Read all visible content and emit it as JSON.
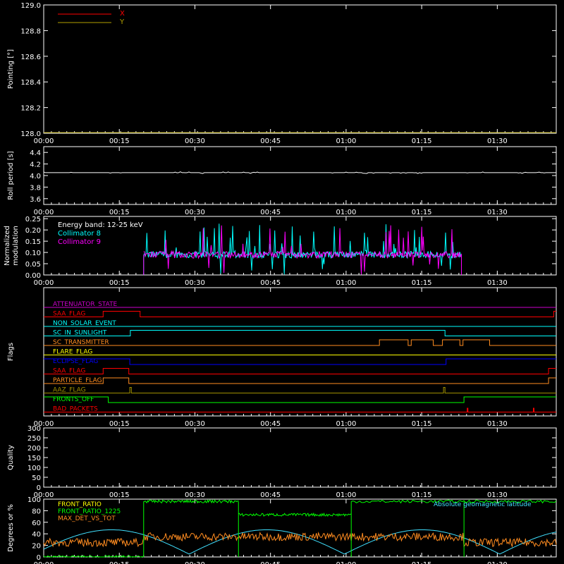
{
  "colors": {
    "background": "#000000",
    "axes": "#ffffff",
    "red": "#ff0000",
    "olive": "#b2a000",
    "cyan": "#00ffff",
    "magenta": "#ff00ff",
    "orange": "#ff8c20",
    "yellow": "#ffff00",
    "blue": "#0000ff",
    "green": "#00ff00",
    "olive_dark": "#a09000",
    "purple": "#cc00cc",
    "lightblue": "#40e0ff"
  },
  "time_ticks": [
    "00:00",
    "00:15",
    "00:30",
    "00:45",
    "01:00",
    "01:15",
    "01:30"
  ],
  "chart_data": [
    {
      "type": "line",
      "ylabel": "Pointing [°]",
      "ylim": [
        128.0,
        129.0
      ],
      "yticks": [
        "128.0",
        "128.2",
        "128.4",
        "128.6",
        "128.8",
        "129.0"
      ],
      "series": [
        {
          "name": "X",
          "color": "#ff0000",
          "values": []
        },
        {
          "name": "Y",
          "color": "#b2a000",
          "values": [
            [
              0,
              128.0
            ],
            [
              100,
              128.0
            ]
          ]
        }
      ]
    },
    {
      "type": "line",
      "ylabel": "Roll period [s]",
      "ylim": [
        3.5,
        4.5
      ],
      "yticks": [
        "3.6",
        "3.8",
        "4.0",
        "4.2",
        "4.4"
      ],
      "series": [
        {
          "color": "#ffffff",
          "values": [
            [
              0,
              4.05
            ],
            [
              100,
              4.05
            ]
          ]
        }
      ]
    },
    {
      "type": "line",
      "ylabel": "Normalized modulation",
      "ylim": [
        0,
        0.26
      ],
      "yticks": [
        "0.00",
        "0.05",
        "0.10",
        "0.15",
        "0.20",
        "0.25"
      ],
      "annotation": "Energy band: 12-25 keV",
      "series": [
        {
          "name": "Collimator 8",
          "color": "#00ffff",
          "start": 19.5,
          "end": 81.5,
          "baseline": 0.09
        },
        {
          "name": "Collimator 9",
          "color": "#ff00ff",
          "start": 19.5,
          "end": 81.5,
          "baseline": 0.09
        }
      ]
    },
    {
      "type": "line",
      "ylabel": "Flags",
      "flags": [
        {
          "name": "ATTENUATOR_STATE",
          "color": "#cc00cc",
          "segments": [
            [
              0,
              100,
              0
            ]
          ]
        },
        {
          "name": "SAA_FLAG",
          "color": "#ff0000",
          "segments": [
            [
              0,
              11.6,
              0
            ],
            [
              11.6,
              18.8,
              1
            ],
            [
              18.8,
              99.5,
              0
            ],
            [
              99.5,
              100,
              1
            ]
          ]
        },
        {
          "name": "NON_SOLAR_EVENT",
          "color": "#00ffff",
          "segments": [
            [
              0,
              100,
              0
            ]
          ]
        },
        {
          "name": "SC_IN_SUNLIGHT",
          "color": "#00ffff",
          "segments": [
            [
              0,
              16.9,
              0
            ],
            [
              16.9,
              78.3,
              1
            ],
            [
              78.3,
              100,
              0
            ]
          ]
        },
        {
          "name": "SC_TRANSMITTER",
          "color": "#ff8c20",
          "segments": [
            [
              0,
              65.5,
              0
            ],
            [
              65.5,
              71.1,
              1
            ],
            [
              71.1,
              71.7,
              0
            ],
            [
              71.7,
              76.0,
              1
            ],
            [
              76.0,
              77.8,
              0
            ],
            [
              77.8,
              81.2,
              1
            ],
            [
              81.2,
              81.8,
              0
            ],
            [
              81.8,
              87.0,
              1
            ],
            [
              87.0,
              100,
              0
            ]
          ]
        },
        {
          "name": "FLARE_FLAG",
          "color": "#ffff00",
          "segments": [
            [
              0,
              100,
              0
            ]
          ]
        },
        {
          "name": "ECLIPSE_FLAG",
          "color": "#0000ff",
          "segments": [
            [
              0,
              16.8,
              1
            ],
            [
              16.8,
              78.5,
              0
            ],
            [
              78.5,
              100,
              1
            ]
          ]
        },
        {
          "name": "SAA_FLAG",
          "color": "#ff0000",
          "segments": [
            [
              0,
              11.6,
              0
            ],
            [
              11.6,
              16.6,
              1
            ],
            [
              16.6,
              98.5,
              0
            ],
            [
              98.5,
              100,
              1
            ]
          ]
        },
        {
          "name": "PARTICLE_FLAG",
          "color": "#ff8c20",
          "segments": [
            [
              0,
              11.6,
              0
            ],
            [
              11.6,
              16.6,
              1
            ],
            [
              16.6,
              98.5,
              0
            ],
            [
              98.5,
              100,
              1
            ]
          ]
        },
        {
          "name": "AAZ_FLAG",
          "color": "#a09000",
          "segments": [
            [
              0,
              16.8,
              0
            ],
            [
              16.8,
              17.1,
              1
            ],
            [
              17.1,
              78.0,
              0
            ],
            [
              78.0,
              78.3,
              1
            ],
            [
              78.3,
              100,
              0
            ]
          ]
        },
        {
          "name": "FRONTS_OFF",
          "color": "#00ff00",
          "segments": [
            [
              0,
              12.6,
              1
            ],
            [
              12.6,
              82.0,
              0
            ],
            [
              82.0,
              100,
              1
            ]
          ]
        },
        {
          "name": "BAD_PACKETS",
          "color": "#ff0000",
          "segments": [
            [
              0,
              100,
              0
            ]
          ],
          "spikes": [
            82.7,
            95.6
          ]
        }
      ]
    },
    {
      "type": "line",
      "ylabel": "Quality",
      "ylim": [
        0,
        300
      ],
      "yticks": [
        "0",
        "50",
        "100",
        "150",
        "200",
        "250",
        "300"
      ],
      "series": []
    },
    {
      "type": "line",
      "ylabel": "Degrees or %",
      "ylim": [
        0,
        100
      ],
      "yticks": [
        "0",
        "20",
        "40",
        "60",
        "80",
        "100"
      ],
      "series": [
        {
          "name": "FRONT_RATIO",
          "color": "#ffff00",
          "values": []
        },
        {
          "name": "FRONT_RATIO_1225",
          "color": "#00ff00",
          "segments": [
            [
              0,
              0,
              19.5
            ],
            [
              19.5,
              96,
              38
            ],
            [
              38,
              73,
              60
            ],
            [
              60,
              96,
              100
            ]
          ]
        },
        {
          "name": "MAX_DET_VS_TOT",
          "color": "#ff8c20",
          "base": 25
        },
        {
          "name": "Absolute geomagnetic latitude",
          "color": "#40e0ff",
          "minmax": [
            5,
            47
          ]
        }
      ]
    }
  ]
}
